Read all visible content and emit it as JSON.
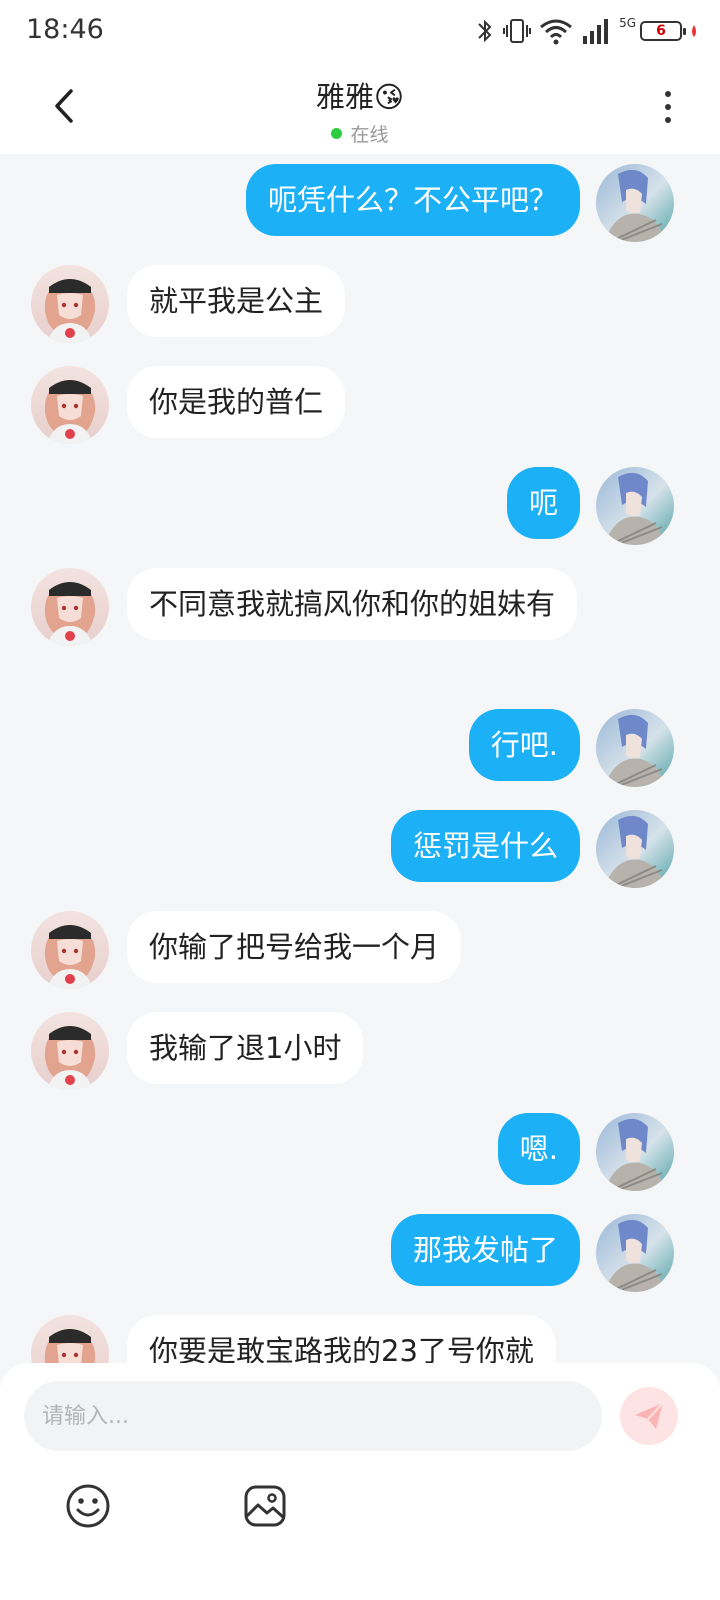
{
  "status_bar": {
    "time": "18:46",
    "network": "5G",
    "battery_level": "6"
  },
  "header": {
    "title": "雅雅😘",
    "presence": "在线"
  },
  "messages": [
    {
      "side": "out",
      "text": "呃凭什么？不公平吧？"
    },
    {
      "side": "in",
      "text": "就平我是公主"
    },
    {
      "side": "in",
      "text": "你是我的普仁"
    },
    {
      "side": "out",
      "text": "呃"
    },
    {
      "side": "in",
      "text": "不同意我就搞风你和你的姐妹有"
    },
    {
      "side": "out",
      "text": "行吧."
    },
    {
      "side": "out",
      "text": "惩罚是什么"
    },
    {
      "side": "in",
      "text": "你输了把号给我一个月"
    },
    {
      "side": "in",
      "text": "我输了退1小时"
    },
    {
      "side": "out",
      "text": "嗯."
    },
    {
      "side": "out",
      "text": "那我发帖了"
    },
    {
      "side": "in",
      "text": "你要是敢宝路我的23了号你就"
    }
  ],
  "input": {
    "placeholder": "请输入..."
  },
  "colors": {
    "outgoing_bubble": "#1cb0f6",
    "incoming_bubble": "#ffffff",
    "background": "#f4f6f8",
    "online": "#2ecc40"
  }
}
